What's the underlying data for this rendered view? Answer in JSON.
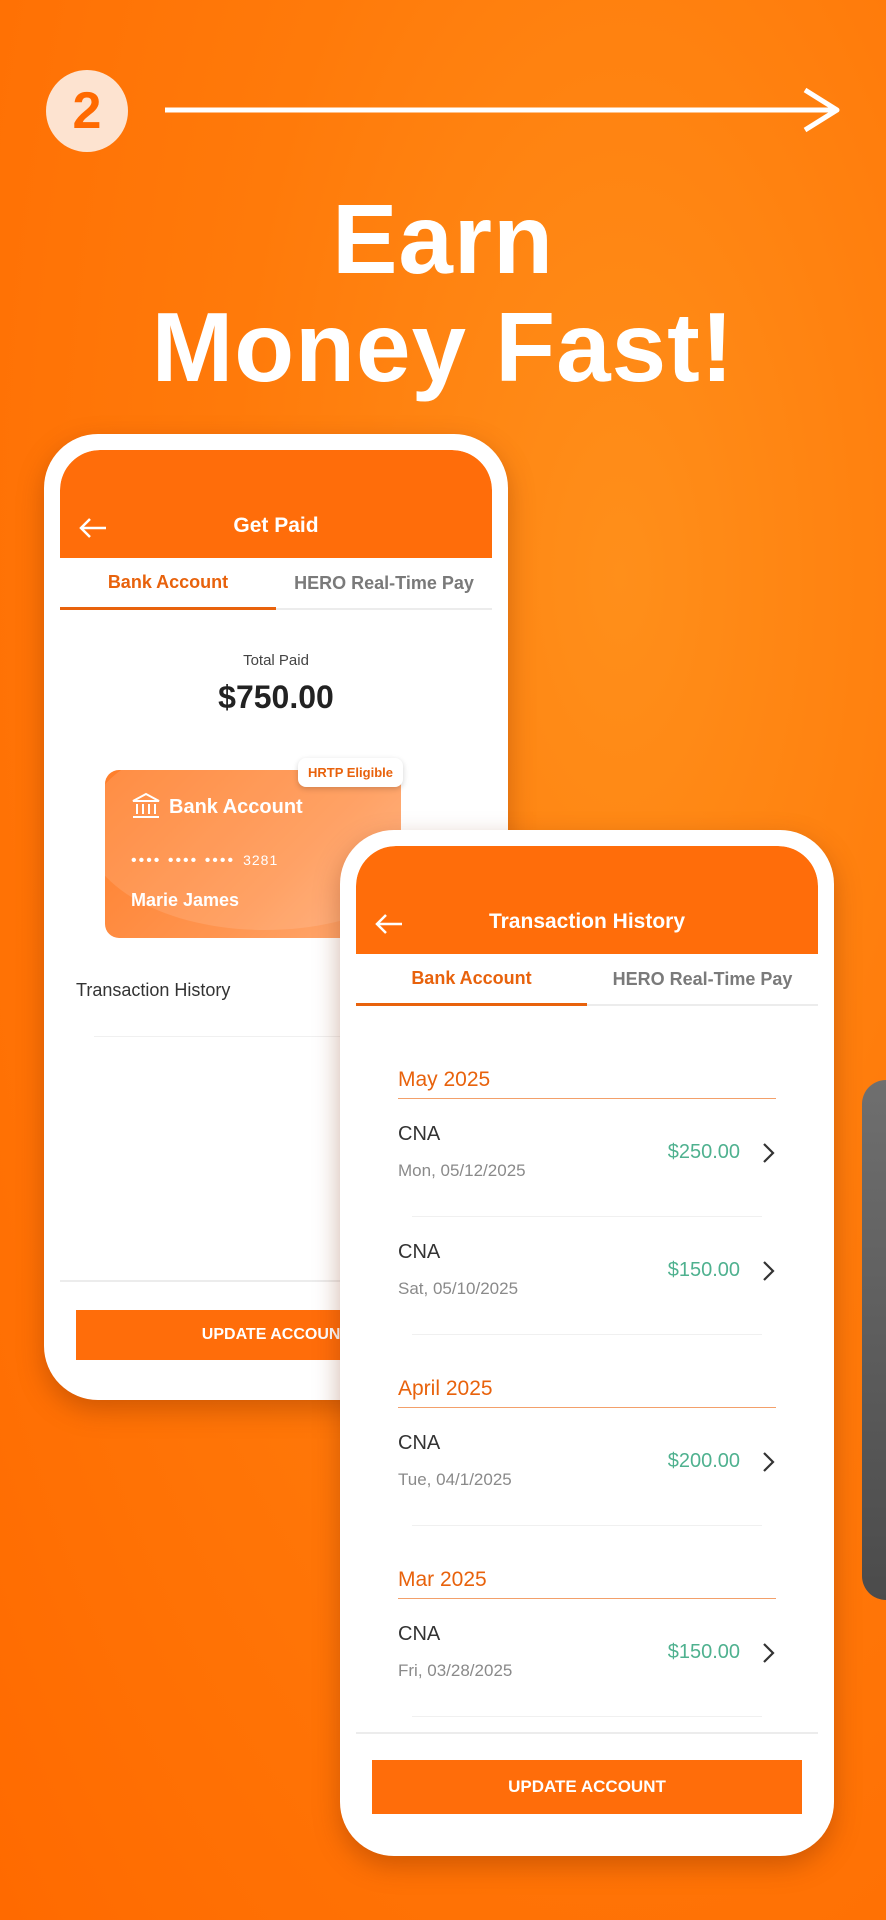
{
  "step_number": "2",
  "headline": {
    "line1": "Earn",
    "line2": "Money Fast!"
  },
  "phone1": {
    "header_title": "Get Paid",
    "tabs": [
      "Bank Account",
      "HERO Real-Time Pay"
    ],
    "total_label": "Total Paid",
    "total_amount": "$750.00",
    "card": {
      "title": "Bank Account",
      "masked": "•••• •••• ••••",
      "last4": "3281",
      "holder": "Marie James",
      "badge": "HRTP Eligible"
    },
    "history_label": "Transaction History",
    "update_button": "UPDATE ACCOUNT"
  },
  "phone2": {
    "header_title": "Transaction History",
    "tabs": [
      "Bank Account",
      "HERO Real-Time Pay"
    ],
    "months": [
      {
        "label": "May 2025",
        "transactions": [
          {
            "type": "CNA",
            "date": "Mon, 05/12/2025",
            "amount": "$250.00"
          },
          {
            "type": "CNA",
            "date": "Sat, 05/10/2025",
            "amount": "$150.00"
          }
        ]
      },
      {
        "label": "April 2025",
        "transactions": [
          {
            "type": "CNA",
            "date": "Tue, 04/1/2025",
            "amount": "$200.00"
          }
        ]
      },
      {
        "label": "Mar 2025",
        "transactions": [
          {
            "type": "CNA",
            "date": "Fri, 03/28/2025",
            "amount": "$150.00"
          }
        ]
      }
    ],
    "update_button": "UPDATE ACCOUNT"
  },
  "colors": {
    "brand_orange": "#ff6d0a",
    "accent_text": "#e8620c",
    "amount_green": "#4fb18f"
  }
}
